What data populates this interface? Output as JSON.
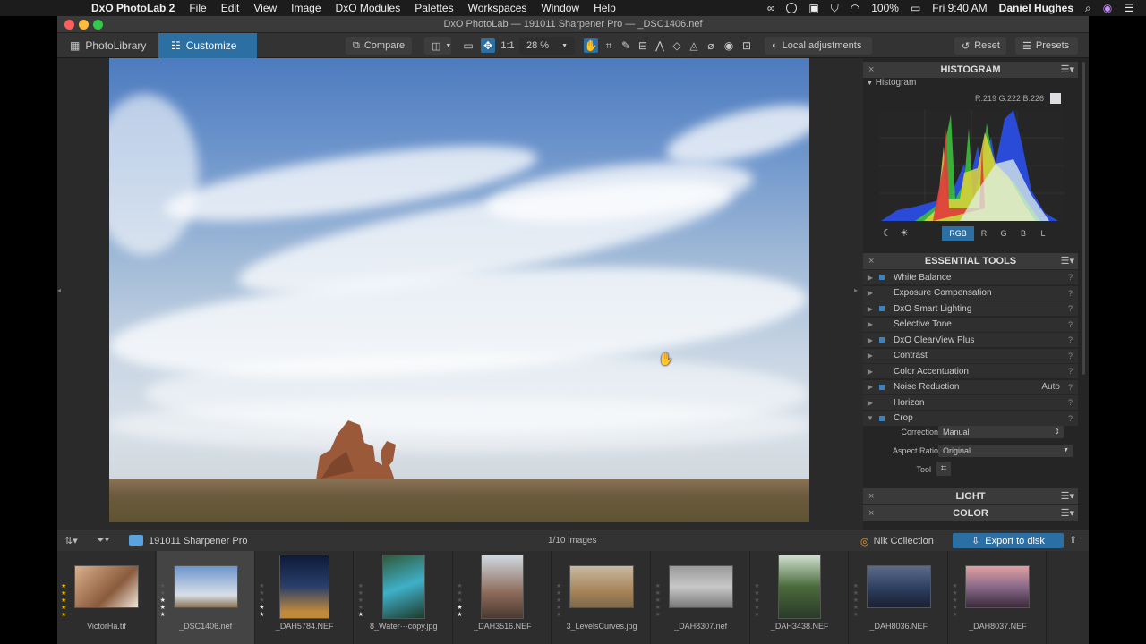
{
  "menubar": {
    "app": "DxO PhotoLab 2",
    "items": [
      "File",
      "Edit",
      "View",
      "Image",
      "DxO Modules",
      "Palettes",
      "Workspaces",
      "Window",
      "Help"
    ],
    "battery": "100%",
    "clock": "Fri 9:40 AM",
    "user": "Daniel Hughes"
  },
  "window": {
    "title": "DxO PhotoLab — 191011 Sharpener Pro — _DSC1406.nef"
  },
  "toolbar": {
    "tab_library": "PhotoLibrary",
    "tab_customize": "Customize",
    "compare": "Compare",
    "one_to_one": "1:1",
    "zoom": "28 %",
    "local_adjustments": "Local adjustments",
    "reset": "Reset",
    "presets": "Presets"
  },
  "histogram": {
    "title": "HISTOGRAM",
    "section": "Histogram",
    "readout": "R:219 G:222 B:226",
    "channels": [
      "RGB",
      "R",
      "G",
      "B",
      "L"
    ],
    "active_channel": "RGB"
  },
  "essential_tools": {
    "title": "ESSENTIAL TOOLS",
    "items": [
      {
        "label": "White Balance",
        "enabled": true
      },
      {
        "label": "Exposure Compensation",
        "enabled": false
      },
      {
        "label": "DxO Smart Lighting",
        "enabled": true
      },
      {
        "label": "Selective Tone",
        "enabled": false
      },
      {
        "label": "DxO ClearView Plus",
        "enabled": true
      },
      {
        "label": "Contrast",
        "enabled": false
      },
      {
        "label": "Color Accentuation",
        "enabled": false
      },
      {
        "label": "Noise Reduction",
        "enabled": true,
        "value": "Auto"
      },
      {
        "label": "Horizon",
        "enabled": false
      },
      {
        "label": "Crop",
        "enabled": true
      }
    ],
    "crop": {
      "correction_label": "Correction",
      "correction_value": "Manual",
      "aspect_label": "Aspect Ratio",
      "aspect_value": "Original",
      "tool_label": "Tool"
    }
  },
  "palettes_collapsed": [
    "LIGHT",
    "COLOR"
  ],
  "bottombar": {
    "folder": "191011 Sharpener Pro",
    "count": "1/10 images",
    "nik": "Nik Collection",
    "export": "Export to disk"
  },
  "filmstrip": [
    {
      "name": "VictorHa.tif",
      "stars": 5
    },
    {
      "name": "_DSC1406.nef",
      "stars": 3,
      "selected": true
    },
    {
      "name": "_DAH5784.NEF",
      "stars": 2
    },
    {
      "name": "8_Water···copy.jpg",
      "stars": 1
    },
    {
      "name": "_DAH3516.NEF",
      "stars": 2
    },
    {
      "name": "3_LevelsCurves.jpg",
      "stars": 0
    },
    {
      "name": "_DAH8307.nef",
      "stars": 0
    },
    {
      "name": "_DAH3438.NEF",
      "stars": 0
    },
    {
      "name": "_DAH8036.NEF",
      "stars": 0
    },
    {
      "name": "_DAH8037.NEF",
      "stars": 0
    }
  ],
  "colors": {
    "accent": "#2b6fa3",
    "star": "#e6b800"
  }
}
